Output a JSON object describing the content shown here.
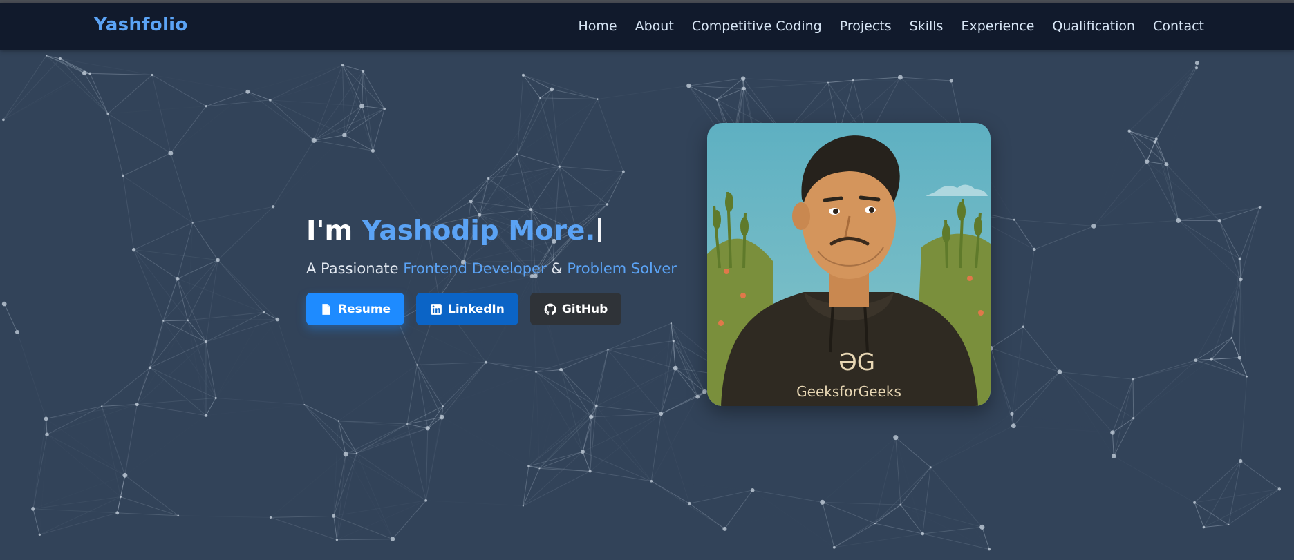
{
  "brand": "Yashfolio",
  "nav": {
    "items": [
      "Home",
      "About",
      "Competitive Coding",
      "Projects",
      "Skills",
      "Experience",
      "Qualification",
      "Contact"
    ]
  },
  "hero": {
    "greeting": "I'm",
    "name": "Yashodip More.",
    "tagline_prefix": "A Passionate",
    "role1": "Frontend Developer",
    "and": "&",
    "role2": "Problem Solver"
  },
  "buttons": {
    "resume": "Resume",
    "linkedin": "LinkedIn",
    "github": "GitHub"
  },
  "avatar": {
    "hoodie_brand": "GeeksforGeeks",
    "hoodie_logo": "ƏG"
  },
  "colors": {
    "accent": "#5ba3f5",
    "nav_bg": "#111a2c",
    "page_bg": "#324359",
    "resume_btn": "#1e8bff",
    "linkedin_btn": "#0b64c6",
    "github_btn": "#2f3338"
  },
  "icons": {
    "resume": "file-icon",
    "linkedin": "linkedin-icon",
    "github": "github-icon"
  }
}
